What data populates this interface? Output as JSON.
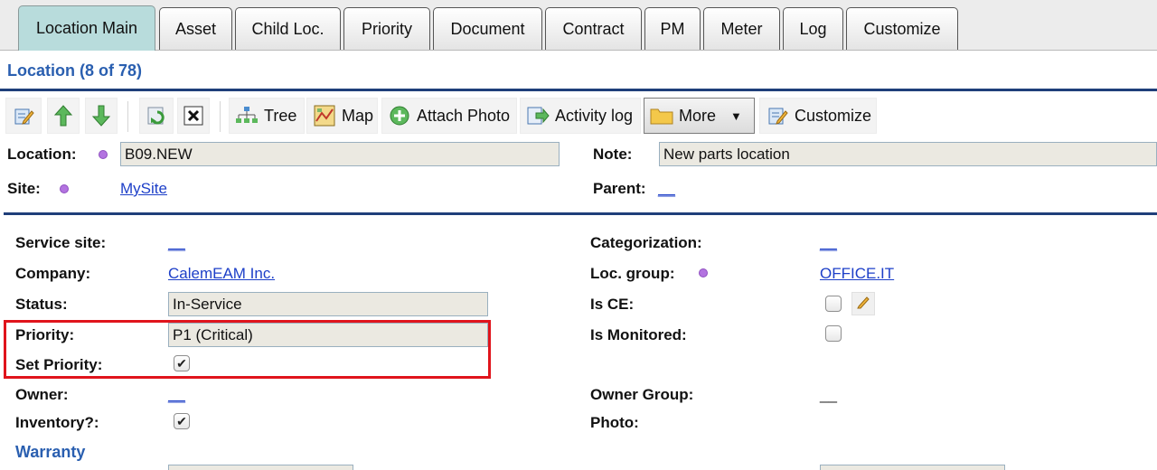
{
  "tabs": [
    {
      "label": "Location Main",
      "active": true
    },
    {
      "label": "Asset"
    },
    {
      "label": "Child Loc."
    },
    {
      "label": "Priority"
    },
    {
      "label": "Document"
    },
    {
      "label": "Contract"
    },
    {
      "label": "PM"
    },
    {
      "label": "Meter"
    },
    {
      "label": "Log"
    },
    {
      "label": "Customize"
    }
  ],
  "header": {
    "title": "Location (8 of 78)"
  },
  "toolbar": {
    "tree": "Tree",
    "map": "Map",
    "attach_photo": "Attach Photo",
    "activity_log": "Activity log",
    "more": "More",
    "customize": "Customize"
  },
  "top_form": {
    "location_label": "Location:",
    "location_value": "B09.NEW",
    "site_label": "Site:",
    "site_value": "MySite",
    "note_label": "Note:",
    "note_value": "New parts location",
    "parent_label": "Parent:",
    "parent_value": "__"
  },
  "detail": {
    "service_site_label": "Service site:",
    "service_site_value": "__",
    "company_label": "Company:",
    "company_value": "CalemEAM Inc.",
    "status_label": "Status:",
    "status_value": "In-Service",
    "priority_label": "Priority:",
    "priority_value": "P1 (Critical)",
    "set_priority_label": "Set Priority:",
    "set_priority_checked": true,
    "owner_label": "Owner:",
    "owner_value": "__",
    "inventory_label": "Inventory?:",
    "inventory_checked": true,
    "categorization_label": "Categorization:",
    "categorization_value": "__",
    "loc_group_label": "Loc. group:",
    "loc_group_value": "OFFICE.IT",
    "is_ce_label": "Is CE:",
    "is_ce_checked": false,
    "is_monitored_label": "Is Monitored:",
    "is_monitored_checked": false,
    "owner_group_label": "Owner Group:",
    "owner_group_value": "__",
    "photo_label": "Photo:",
    "warranty_label": "Warranty"
  },
  "colors": {
    "title_blue": "#2a5fb0",
    "link_blue": "#1d3fc8",
    "divider_navy": "#1f3f7a",
    "highlight_red": "#e0141c",
    "active_tab": "#b8dcdc",
    "required_dot": "#b373e0"
  },
  "check_mark": "✔"
}
